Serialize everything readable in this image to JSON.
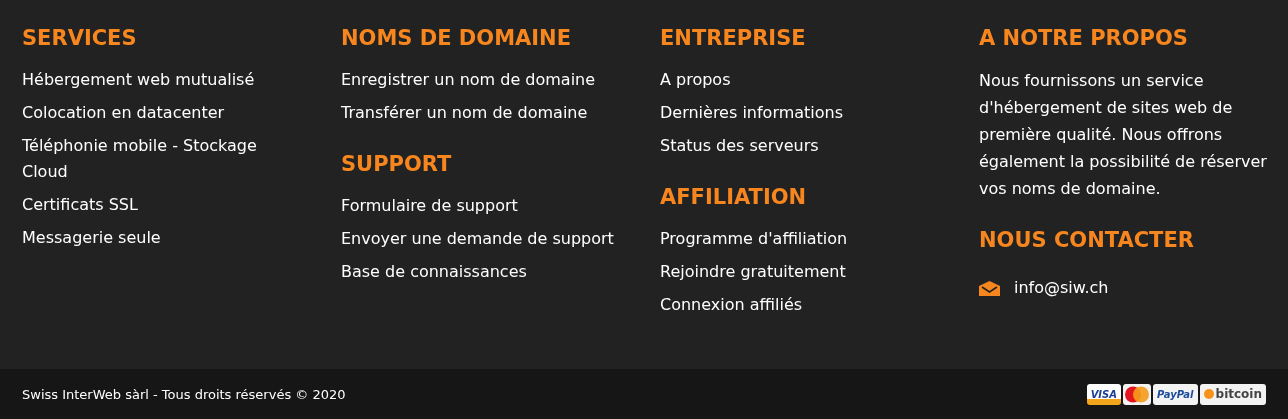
{
  "columns": [
    {
      "sections": [
        {
          "kind": "links",
          "title": "SERVICES",
          "items": [
            "Hébergement web mutualisé",
            "Colocation en datacenter",
            "Téléphonie mobile - Stockage Cloud",
            "Certificats SSL",
            "Messagerie seule"
          ]
        }
      ]
    },
    {
      "sections": [
        {
          "kind": "links",
          "title": "NOMS DE DOMAINE",
          "items": [
            "Enregistrer un nom de domaine",
            "Transférer un nom de domaine"
          ]
        },
        {
          "kind": "links",
          "title": "SUPPORT",
          "items": [
            "Formulaire de support",
            "Envoyer une demande de support",
            "Base de connaissances"
          ]
        }
      ]
    },
    {
      "sections": [
        {
          "kind": "links",
          "title": "ENTREPRISE",
          "items": [
            "A propos",
            "Dernières informations",
            "Status des serveurs"
          ]
        },
        {
          "kind": "links",
          "title": "AFFILIATION",
          "items": [
            "Programme d'affiliation",
            "Rejoindre gratuitement",
            "Connexion affiliés"
          ]
        }
      ]
    },
    {
      "sections": [
        {
          "kind": "text",
          "title": "A NOTRE PROPOS",
          "text": "Nous fournissons un service d'hébergement de sites web de première qualité. Nous offrons également la possibilité de réserver vos noms de domaine."
        },
        {
          "kind": "contact",
          "title": "NOUS CONTACTER",
          "email": "info@siw.ch"
        }
      ]
    }
  ],
  "footer": {
    "copyright": "Swiss InterWeb sàrl - Tous droits réservés © 2020",
    "payments": [
      {
        "kind": "visa",
        "label": "VISA"
      },
      {
        "kind": "mastercard"
      },
      {
        "kind": "paypal",
        "label": "PayPal"
      },
      {
        "kind": "bitcoin",
        "label": "bitcoin"
      }
    ]
  }
}
